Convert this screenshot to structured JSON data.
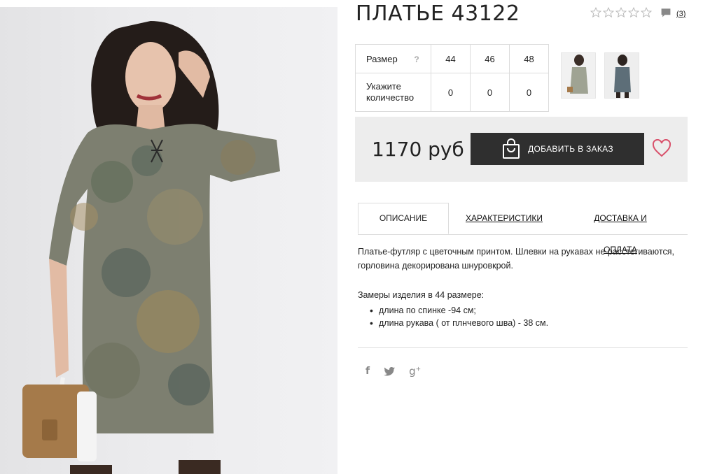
{
  "product": {
    "title": "ПЛАТЬЕ 43122",
    "review_count": "(3)",
    "rating_stars": 0,
    "rating_max": 5
  },
  "sizes": {
    "size_label": "Размер",
    "help": "?",
    "quantity_label": "Укажите количество",
    "values": [
      "44",
      "46",
      "48"
    ],
    "quantities": [
      "0",
      "0",
      "0"
    ]
  },
  "buy": {
    "price": "1170 руб",
    "add_button": "ДОБАВИТЬ В ЗАКАЗ"
  },
  "tabs": {
    "description": "ОПИСАНИЕ",
    "characteristics": "ХАРАКТЕРИСТИКИ",
    "delivery": "ДОСТАВКА И ОПЛАТА"
  },
  "description": {
    "text": "Платье-футляр с цветочным принтом. Шлевки на рукавах не расстегиваются, горловина декорирована шнуровкрой.",
    "measure_title": "Замеры изделия в 44 размере:",
    "measures": [
      "длина по спинке -94 см;",
      "длина рукава ( от плнчевого шва) - 38 см."
    ]
  },
  "social": {
    "facebook": "f",
    "twitter": "twitter-icon",
    "googleplus": "g"
  },
  "colors": {
    "button_bg": "#2f2f2f",
    "buy_box_bg": "#ededed",
    "heart": "#d9516b"
  },
  "icons": [
    "star-icon",
    "comment-icon",
    "bag-icon",
    "heart-icon",
    "facebook-icon",
    "twitter-icon",
    "google-plus-icon"
  ]
}
